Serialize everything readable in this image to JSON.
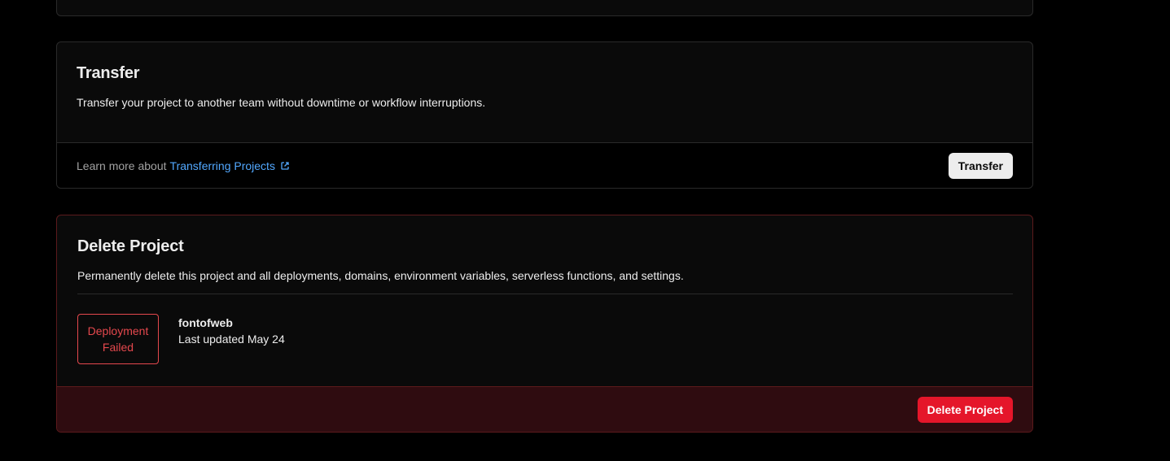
{
  "transfer": {
    "title": "Transfer",
    "description": "Transfer your project to another team without downtime or workflow interruptions.",
    "footer_text": "Learn more about",
    "link_label": "Transferring Projects",
    "link_icon": "external-link-icon",
    "button_label": "Transfer"
  },
  "delete_project": {
    "title": "Delete Project",
    "description": "Permanently delete this project and all deployments, domains, environment variables, serverless functions, and settings.",
    "status_line1": "Deployment",
    "status_line2": "Failed",
    "project_name": "fontofweb",
    "last_updated": "Last updated May 24",
    "button_label": "Delete Project"
  },
  "colors": {
    "background": "#000000",
    "card": "#0a0a0a",
    "link": "#52a8ff",
    "danger": "#e5162a",
    "danger_footer": "#2f0c10",
    "status_error": "#e5484d"
  }
}
